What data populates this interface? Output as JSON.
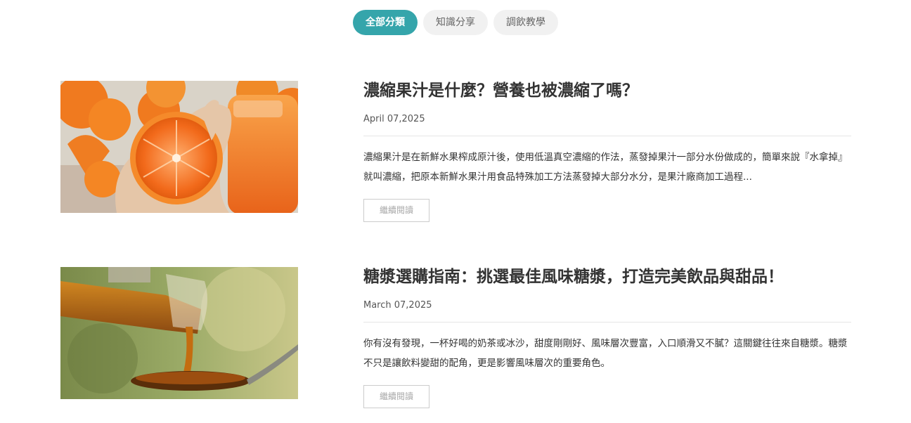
{
  "tabs": [
    {
      "label": "全部分類",
      "active": true
    },
    {
      "label": "知識分享",
      "active": false
    },
    {
      "label": "調飲教學",
      "active": false
    }
  ],
  "posts": [
    {
      "title": "濃縮果汁是什麼？營養也被濃縮了嗎？",
      "date": "April 07,2025",
      "excerpt": "濃縮果汁是在新鮮水果榨成原汁後，使用低溫真空濃縮的作法，蒸發掉果汁一部分水份做成的，簡單來說『水拿掉』就叫濃縮，把原本新鮮水果汁用食品特殊加工方法蒸發掉大部分水分，是果汁廠商加工過程...",
      "read_more": "繼續閱讀",
      "image": "orange-juice-photo"
    },
    {
      "title": "糖漿選購指南：挑選最佳風味糖漿，打造完美飲品與甜品！",
      "date": "March 07,2025",
      "excerpt": "你有沒有發現，一杯好喝的奶茶或冰沙，甜度剛剛好、風味層次豐富，入口順滑又不膩？這關鍵往往來自糖漿。糖漿不只是讓飲料變甜的配角，更是影響風味層次的重要角色。",
      "read_more": "繼續閱讀",
      "image": "syrup-pour-photo"
    }
  ],
  "colors": {
    "accent": "#35a5ab",
    "tab_bg": "#f1f1f1"
  }
}
